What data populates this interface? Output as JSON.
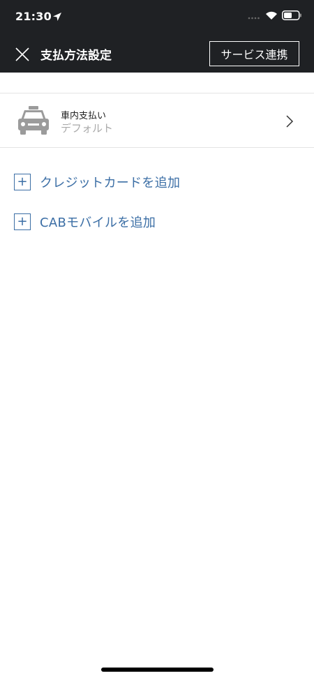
{
  "status_bar": {
    "time": "21:30"
  },
  "header": {
    "title": "支払方法設定",
    "service_button_label": "サービス連携"
  },
  "payment_method": {
    "name": "車内支払い",
    "status": "デフォルト"
  },
  "actions": {
    "add_credit_card": "クレジットカードを追加",
    "add_cab_mobile": "CABモバイルを追加"
  },
  "icons": {
    "location": "location-arrow-icon",
    "signal": "signal-icon",
    "wifi": "wifi-icon",
    "battery": "battery-icon",
    "close": "close-icon",
    "taxi": "taxi-icon",
    "chevron": "chevron-right-icon",
    "plus": "plus-icon"
  },
  "colors": {
    "header_background": "#1f2124",
    "link_blue": "#3b6ea5",
    "subtext_gray": "#aaaaaa",
    "icon_gray": "#9b9b9b"
  }
}
